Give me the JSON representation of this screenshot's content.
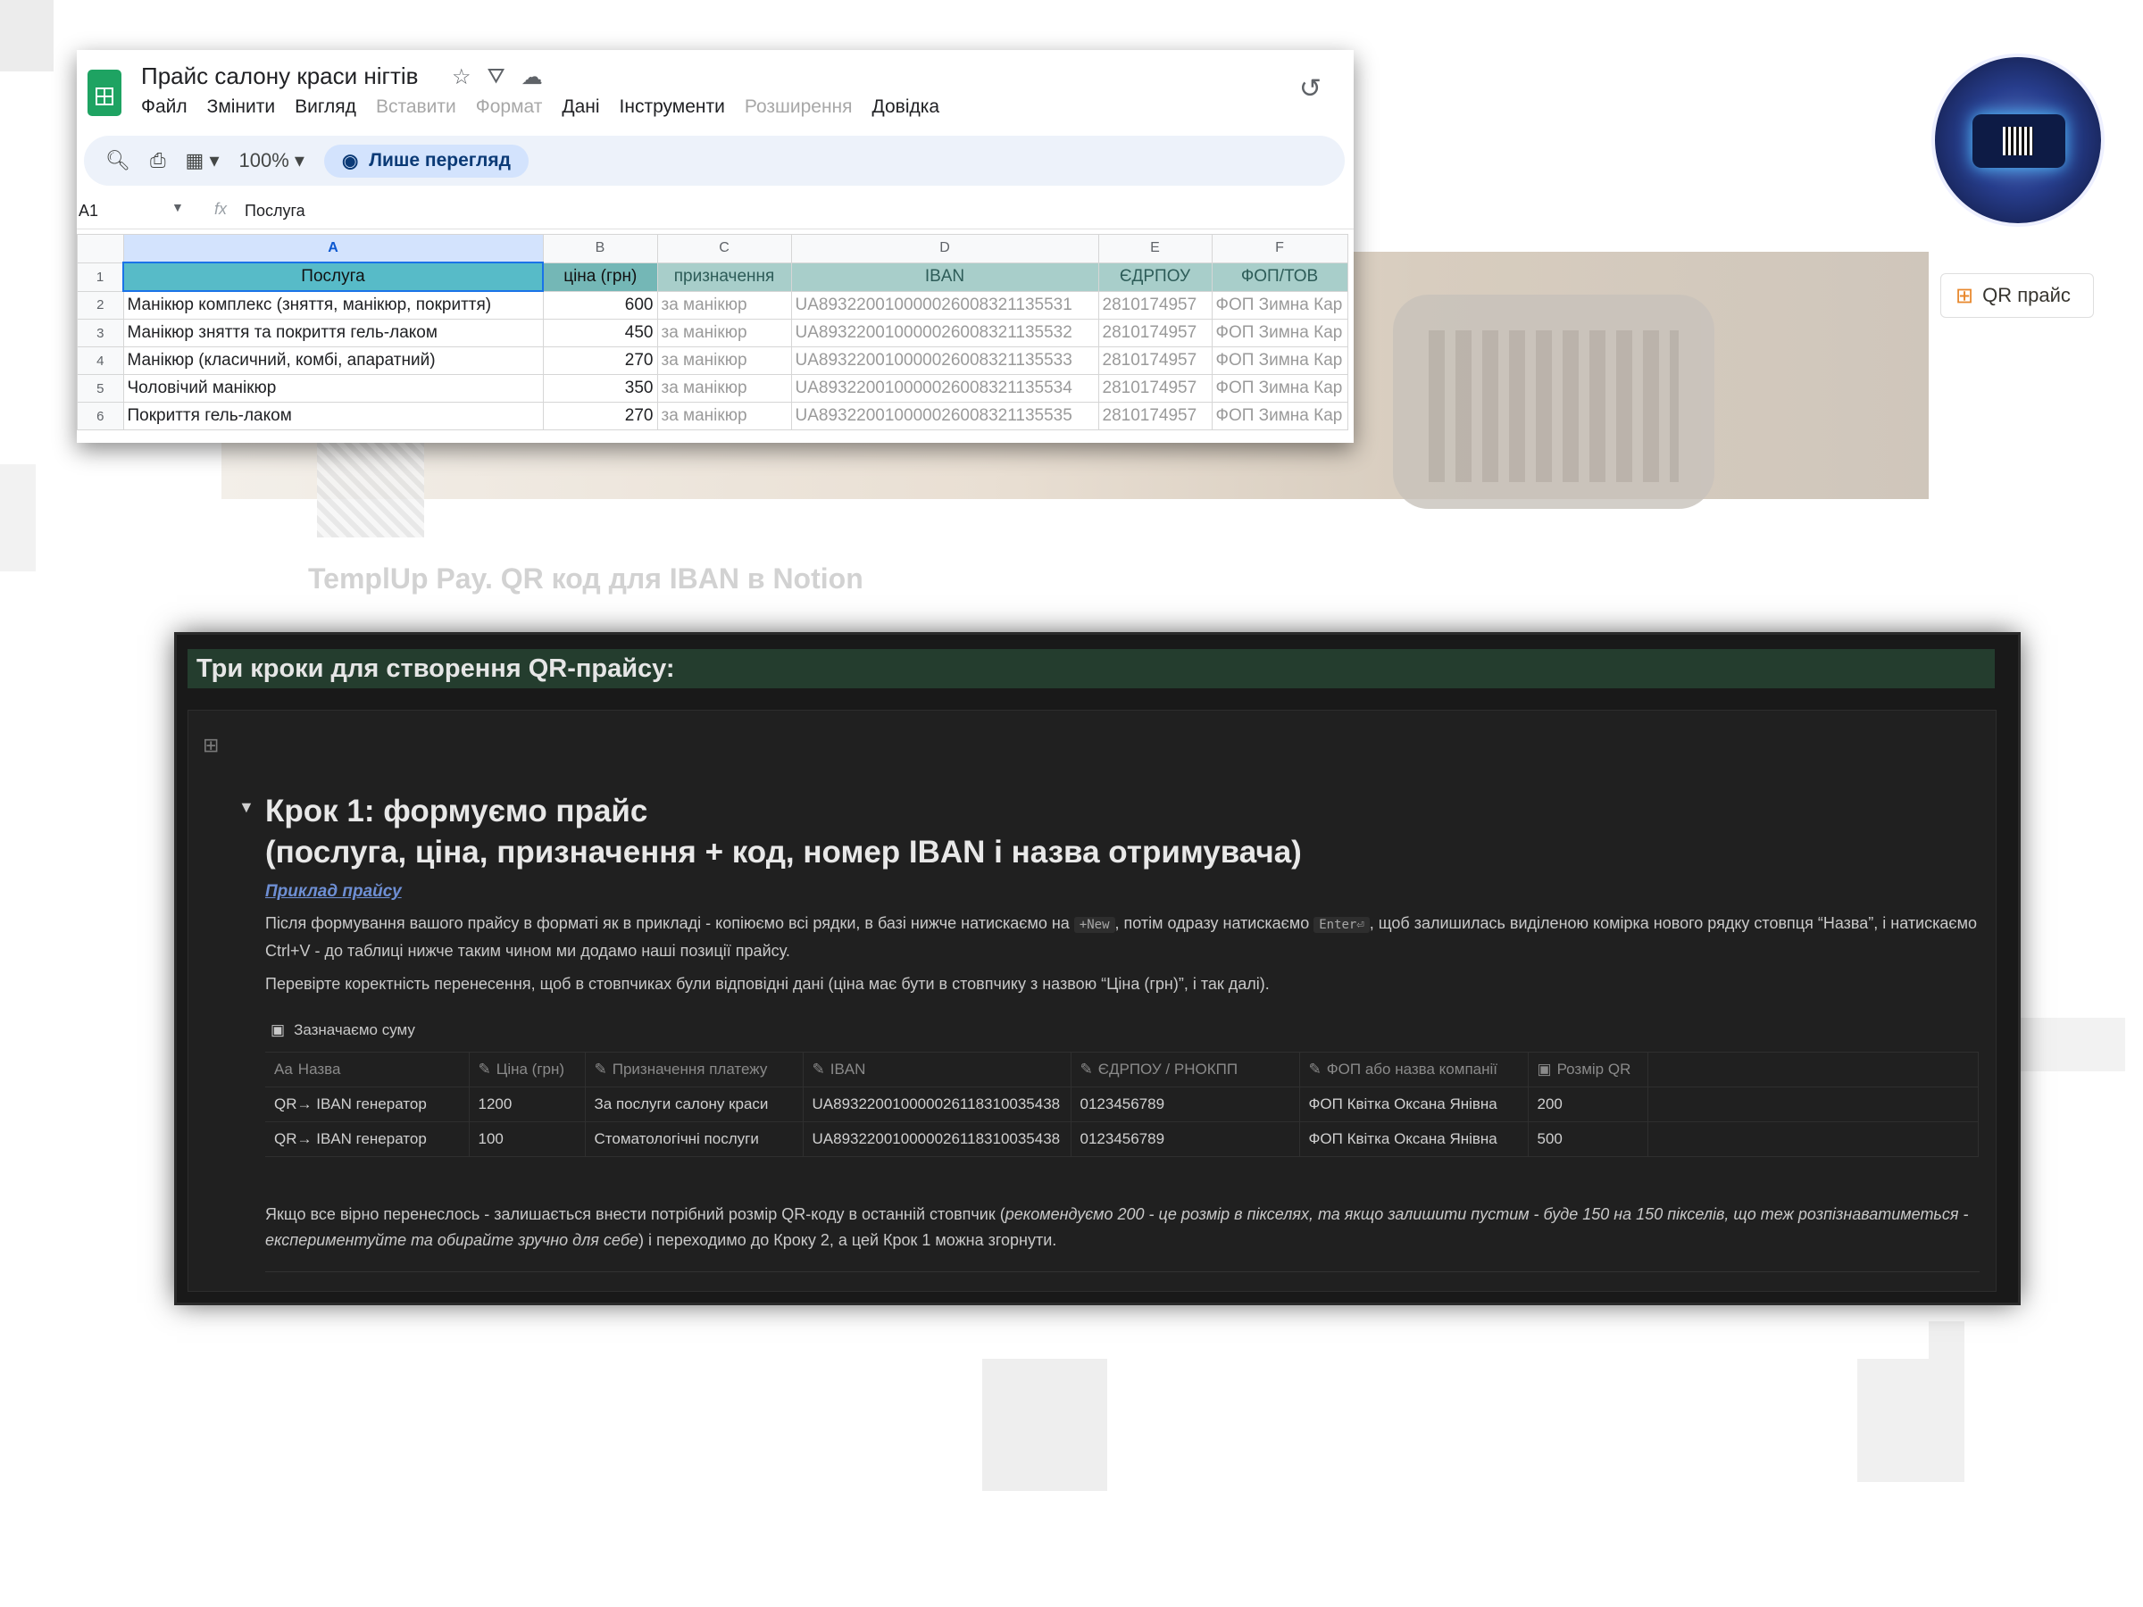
{
  "spreadsheet": {
    "title": "Прайс салону краси нігтів",
    "menu": [
      {
        "label": "Файл",
        "enabled": true
      },
      {
        "label": "Змінити",
        "enabled": true
      },
      {
        "label": "Вигляд",
        "enabled": true
      },
      {
        "label": "Вставити",
        "enabled": false
      },
      {
        "label": "Формат",
        "enabled": false
      },
      {
        "label": "Дані",
        "enabled": true
      },
      {
        "label": "Інструменти",
        "enabled": true
      },
      {
        "label": "Розширення",
        "enabled": false
      },
      {
        "label": "Довідка",
        "enabled": true
      }
    ],
    "zoom": "100%",
    "view_mode": "Лише перегляд",
    "cell_ref": "A1",
    "formula_value": "Послуга",
    "column_letters": [
      "A",
      "B",
      "C",
      "D",
      "E",
      "F"
    ],
    "headers": [
      "Послуга",
      "ціна (грн)",
      "призначення",
      "IBAN",
      "ЄДРПОУ",
      "ФОП/ТОВ"
    ],
    "rows": [
      {
        "num": "2",
        "cells": [
          "Манікюр комплекс (зняття, манікюр, покриття)",
          "600",
          "за манікюр",
          "UA893220010000026008321135531",
          "2810174957",
          "ФОП Зимна Кар"
        ]
      },
      {
        "num": "3",
        "cells": [
          "Манікюр зняття та покриття гель-лаком",
          "450",
          "за манікюр",
          "UA893220010000026008321135532",
          "2810174957",
          "ФОП Зимна Кар"
        ]
      },
      {
        "num": "4",
        "cells": [
          "Манікюр (класичний, комбі, апаратний)",
          "270",
          "за манікюр",
          "UA893220010000026008321135533",
          "2810174957",
          "ФОП Зимна Кар"
        ]
      },
      {
        "num": "5",
        "cells": [
          "Чоловічий манікюр",
          "350",
          "за манікюр",
          "UA893220010000026008321135534",
          "2810174957",
          "ФОП Зимна Кар"
        ]
      },
      {
        "num": "6",
        "cells": [
          "Покриття гель-лаком",
          "270",
          "за манікюр",
          "UA893220010000026008321135535",
          "2810174957",
          "ФОП Зимна Кар"
        ]
      }
    ],
    "header_row_num": "1"
  },
  "page": {
    "title": "TemplUp Pay. QR код для IBAN в Notion",
    "qr_button": "QR прайс"
  },
  "panel": {
    "heading": "Три кроки для створення QR-прайсу:",
    "step_title_line1": "Крок 1: формуємо прайс",
    "step_title_line2": "(послуга, ціна, призначення + код, номер IBAN і назва отримувача)",
    "example_link": "Приклад прайсу",
    "para1_a": "Після формування вашого прайсу в форматі як в прикладі - копіюємо всі рядки, в базі нижче натискаємо на ",
    "code_new": "+New",
    "para1_b": ", потім одразу натискаємо ",
    "code_enter": "Enter⏎",
    "para1_c": ", щоб залишилась виділеною комірка нового рядку стовпця “Назва”, і натискаємо Ctrl+V - до таблиці нижче таким чином ми додамо наші позиції прайсу.",
    "para2": "Перевірте коректність перенесення, щоб в стовпчиках були відповідні дані (ціна має бути в стовпчику з назвою “Ціна (грн)”, і так далі).",
    "db_title": "Зазначаємо суму",
    "db_headers": [
      "Назва",
      "Ціна (грн)",
      "Призначення платежу",
      "IBAN",
      "ЄДРПОУ / РНОКПП",
      "ФОП або назва компанії",
      "Розмір QR"
    ],
    "db_header_prefix_name": "Aa",
    "db_rows": [
      [
        "QR→ IBAN генератор",
        "1200",
        "За послуги салону краси",
        "UA893220010000026118310035438",
        "0123456789",
        "ФОП Квітка Оксана Янівна",
        "200"
      ],
      [
        "QR→ IBAN генератор",
        "100",
        "Стоматологічні послуги",
        "UA893220010000026118310035438",
        "0123456789",
        "ФОП Квітка Оксана Янівна",
        "500"
      ]
    ],
    "footer_a": "Якщо все вірно перенеслось - залишається внести потрібний розмір QR-коду в останній стовпчик (",
    "footer_italic": "рекомендуємо 200 - це розмір в пікселях, та якщо залишити пустим - буде 150 на 150 пікселів, що теж розпізнаватиметься - експериментуйте та обирайте зручно для себе",
    "footer_b": ") і переходимо до Кроку 2, а цей Крок 1 можна згорнути."
  },
  "icons": {
    "sheets": "sheets-logo-icon",
    "star": "star-icon",
    "drive": "drive-move-icon",
    "cloud": "cloud-icon",
    "history": "history-icon",
    "search": "search-icon",
    "print": "print-icon",
    "format": "paint-format-icon",
    "eye": "eye-icon",
    "fx": "function-icon",
    "qr": "qr-grid-icon"
  }
}
